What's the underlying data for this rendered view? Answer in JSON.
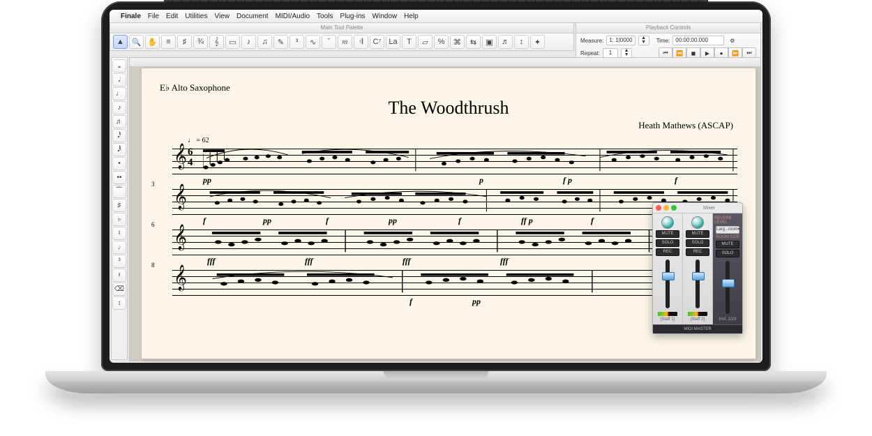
{
  "menubar": {
    "app": "Finale",
    "items": [
      "File",
      "Edit",
      "Utilities",
      "View",
      "Document",
      "MIDI/Audio",
      "Tools",
      "Plug-ins",
      "Window",
      "Help"
    ]
  },
  "tool_palette": {
    "title": "Main Tool Palette"
  },
  "playback": {
    "title": "Playback Controls",
    "measure_label": "Measure:",
    "measure_value": "1: 1|0000",
    "time_label": "Time:",
    "time_value": "00:00:00.000",
    "repeat_label": "Repeat:",
    "repeat_value": "1"
  },
  "document": {
    "instrument": "E♭ Alto Saxophone",
    "title": "The Woodthrush",
    "composer": "Heath Mathews (ASCAP)",
    "tempo_mark": "♩ = 62",
    "time_sig": {
      "num": "6",
      "den": "4"
    },
    "measures": [
      "",
      "3",
      "6",
      "8"
    ],
    "dynamics": {
      "s1": [
        "pp",
        "p",
        "f  p",
        "f"
      ],
      "s2": [
        "f",
        "pp",
        "f",
        "pp",
        "f",
        "ff  p",
        "f"
      ],
      "s3": [
        "fff",
        "fff",
        "fff",
        "fff"
      ],
      "s4": [
        "f",
        "pp"
      ]
    }
  },
  "mixer": {
    "title": "Mixer",
    "buttons": {
      "mute": "MUTE",
      "solo": "SOLO",
      "rec": "REC"
    },
    "reverb": "REVERB LEVEL",
    "room": "ROOM SIZE",
    "strips": [
      "[Staff 1]",
      "[Staff 2]",
      "Inst. 1/23"
    ],
    "footer": "MIDI MASTER"
  }
}
